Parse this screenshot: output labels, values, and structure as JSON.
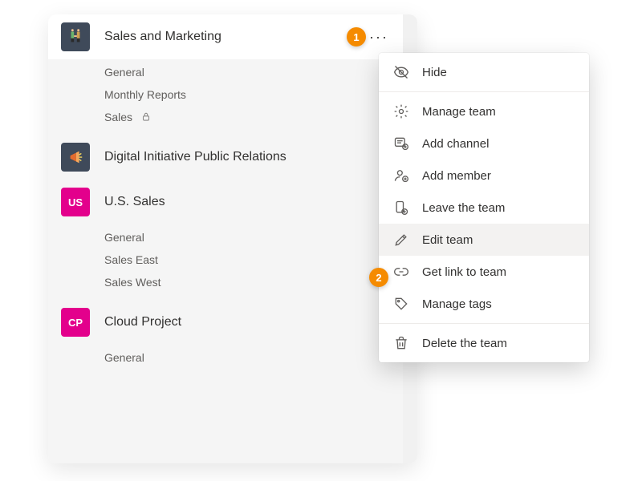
{
  "callouts": {
    "one": "1",
    "two": "2"
  },
  "teams": [
    {
      "name": "Sales and Marketing",
      "avatar_kind": "handshake",
      "channels": [
        {
          "label": "General"
        },
        {
          "label": "Monthly Reports"
        },
        {
          "label": "Sales",
          "private": true
        }
      ],
      "active": true
    },
    {
      "name": "Digital Initiative Public Relations",
      "avatar_kind": "megaphone",
      "channels": []
    },
    {
      "name": "U.S. Sales",
      "avatar_initials": "US",
      "channels": [
        {
          "label": "General"
        },
        {
          "label": "Sales East"
        },
        {
          "label": "Sales West"
        }
      ]
    },
    {
      "name": "Cloud Project",
      "avatar_initials": "CP",
      "channels": [
        {
          "label": "General"
        }
      ]
    }
  ],
  "menu": {
    "hide": "Hide",
    "manage_team": "Manage team",
    "add_channel": "Add channel",
    "add_member": "Add member",
    "leave_team": "Leave the team",
    "edit_team": "Edit team",
    "get_link": "Get link to team",
    "manage_tags": "Manage tags",
    "delete_team": "Delete the team"
  }
}
